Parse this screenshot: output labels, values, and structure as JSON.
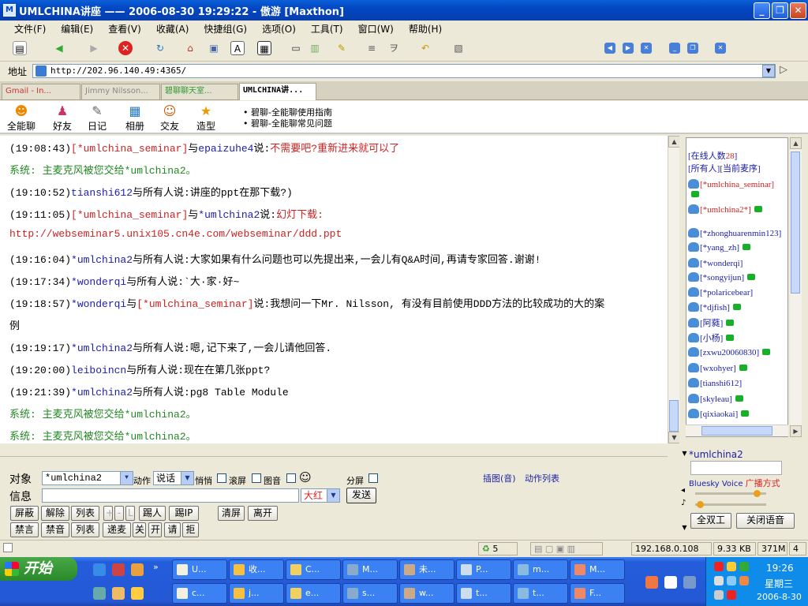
{
  "window": {
    "title": "UMLCHINA讲座 —— 2006-08-30 19:29:22 - 傲游 [Maxthon]"
  },
  "menu": [
    "文件(F)",
    "编辑(E)",
    "查看(V)",
    "收藏(A)",
    "快捷组(G)",
    "选项(O)",
    "工具(T)",
    "窗口(W)",
    "帮助(H)"
  ],
  "address": {
    "label": "地址",
    "url": "http://202.96.140.49:4365/"
  },
  "tabs": [
    "Gmail - In...",
    "Jimmy Nilsson...",
    "碧聊聊天室...",
    "UMLCHINA讲..."
  ],
  "nav": [
    "全能聊",
    "好友",
    "日记",
    "相册",
    "交友",
    "造型"
  ],
  "links": [
    "碧聊-全能聊使用指南",
    "碧聊-全能聊常见问题"
  ],
  "messages": [
    {
      "time": "(19:08:43)",
      "parts": [
        [
          "r",
          "[*umlchina_seminar]"
        ],
        [
          "t",
          "与"
        ],
        [
          "u",
          "epaizuhe4"
        ],
        [
          "t",
          "说:"
        ],
        [
          "r",
          "不需要吧?重新进来就可以了"
        ]
      ]
    },
    {
      "time": "",
      "parts": [
        [
          "g",
          "系统:  主麦克风被您交给*umlchina2。"
        ]
      ]
    },
    {
      "time": "(19:10:52)",
      "parts": [
        [
          "u",
          "tianshi612"
        ],
        [
          "t",
          "与所有人说:讲座的ppt在那下载?)"
        ]
      ]
    },
    {
      "time": "(19:11:05)",
      "parts": [
        [
          "r",
          "[*umlchina_seminar]"
        ],
        [
          "t",
          "与"
        ],
        [
          "u",
          "*umlchina2"
        ],
        [
          "t",
          "说:"
        ],
        [
          "r",
          "幻灯下载:"
        ]
      ]
    },
    {
      "time": "",
      "parts": [
        [
          "r",
          "http://webseminar5.unix105.cn4e.com/webseminar/ddd.ppt"
        ]
      ]
    },
    {
      "time": "(19:16:04)",
      "parts": [
        [
          "u",
          "*umlchina2"
        ],
        [
          "t",
          "与所有人说:大家如果有什么问题也可以先提出来,一会儿有Q&A时间,再请专家回答.谢谢!"
        ]
      ]
    },
    {
      "time": "(19:17:34)",
      "parts": [
        [
          "u",
          "*wonderqi"
        ],
        [
          "t",
          "与所有人说:`大·家·好~"
        ]
      ]
    },
    {
      "time": "(19:18:57)",
      "parts": [
        [
          "u",
          "*wonderqi"
        ],
        [
          "t",
          "与"
        ],
        [
          "r",
          "[*umlchina_seminar]"
        ],
        [
          "t",
          "说:我想问一下Mr. Nilsson, 有没有目前使用DDD方法的比较成功的大的案"
        ]
      ]
    },
    {
      "time": "",
      "parts": [
        [
          "t",
          "例"
        ]
      ]
    },
    {
      "time": "(19:19:17)",
      "parts": [
        [
          "u",
          "*umlchina2"
        ],
        [
          "t",
          "与所有人说:嗯,记下来了,一会儿请他回答."
        ]
      ]
    },
    {
      "time": "(19:20:00)",
      "parts": [
        [
          "u",
          "leiboincn"
        ],
        [
          "t",
          "与所有人说:现在在第几张ppt?"
        ]
      ]
    },
    {
      "time": "(19:21:39)",
      "parts": [
        [
          "u",
          "*umlchina2"
        ],
        [
          "t",
          "与所有人说:pg8 Table Module"
        ]
      ]
    },
    {
      "time": "",
      "parts": [
        [
          "g",
          "系统:  主麦克风被您交给*umlchina2。"
        ]
      ]
    },
    {
      "time": "",
      "parts": [
        [
          "g",
          "系统:  主麦克风被您交给*umlchina2。"
        ]
      ]
    }
  ],
  "online": {
    "label": "[在线人数",
    "count": "28",
    "tail": "]",
    "tabs": "[所有人][当前麦序]",
    "users": [
      {
        "name": "[*umlchina_seminar]",
        "red": true,
        "phone": false
      },
      {
        "name": "",
        "red": false,
        "phone": true
      },
      {
        "name": "[*umlchina2*]",
        "red": true,
        "phone": true
      },
      {
        "name": "[*zhonghuarenmin123]",
        "red": false,
        "phone": false
      },
      {
        "name": "[*yang_zh]",
        "red": false,
        "phone": true
      },
      {
        "name": "[*wonderqi]",
        "red": false,
        "phone": false
      },
      {
        "name": "[*songyijun]",
        "red": false,
        "phone": true
      },
      {
        "name": "[*polaricebear]",
        "red": false,
        "phone": false
      },
      {
        "name": "[*djfish]",
        "red": false,
        "phone": true
      },
      {
        "name": "[阿蕤]",
        "red": false,
        "phone": true
      },
      {
        "name": "[小杨]",
        "red": false,
        "phone": true
      },
      {
        "name": "[zxwu20060830]",
        "red": false,
        "phone": true
      },
      {
        "name": "[wxohyer]",
        "red": false,
        "phone": true
      },
      {
        "name": "[tianshi612]",
        "red": false,
        "phone": false
      },
      {
        "name": "[skyleau]",
        "red": false,
        "phone": true
      },
      {
        "name": "[qixiaokai]",
        "red": false,
        "phone": true
      }
    ]
  },
  "voice": {
    "user": "*umlchina2",
    "brand": "Bluesky Voice",
    "mode": "广播方式",
    "duplex": "全双工",
    "close": "关闭语音"
  },
  "input": {
    "target_label": "对象",
    "target": "*umlchina2",
    "action_label": "动作",
    "action": "说话",
    "whisper": "悄悄",
    "scroll": "滚屏",
    "image": "图音",
    "split": "分屏",
    "msg_label": "信息",
    "color": "大红",
    "send": "发送",
    "insert": "插图(音)",
    "actionlist": "动作列表"
  },
  "buttons1": [
    "屏蔽",
    "解除",
    "列表",
    "+",
    "-",
    "L",
    "踢人",
    "踢IP",
    "清屏",
    "离开"
  ],
  "buttons2": [
    "禁言",
    "禁音",
    "列表",
    "递麦",
    "关",
    "开",
    "请",
    "拒"
  ],
  "status": {
    "count": "5",
    "ip": "192.168.0.108",
    "size": "9.33 KB",
    "mem": "371M",
    "num": "4"
  },
  "taskbar": {
    "start": "开始",
    "row1": [
      "U...",
      "收...",
      "C...",
      "M...",
      "未...",
      "P...",
      "m...",
      "M..."
    ],
    "row2": [
      "c...",
      "j...",
      "e...",
      "s...",
      "w...",
      "t...",
      "t...",
      "F..."
    ],
    "time": "19:26",
    "day": "星期三",
    "date": "2006-8-30"
  }
}
